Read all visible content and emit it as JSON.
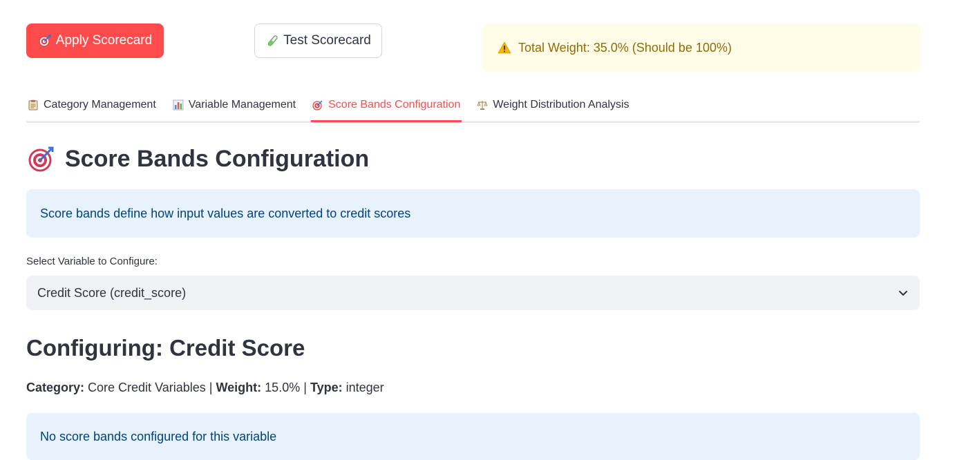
{
  "toolbar": {
    "apply_label": "Apply Scorecard",
    "test_label": "Test Scorecard",
    "colors": {
      "primary": "#ff4b4b",
      "secondary_border": "#d3d5da"
    }
  },
  "warning": {
    "text": "Total Weight: 35.0% (Should be 100%)",
    "icon": "warning-icon",
    "colors": {
      "bg": "#fffce7",
      "text": "#926c05"
    }
  },
  "tabs": [
    {
      "label": "Category Management",
      "icon": "clipboard-icon",
      "active": false
    },
    {
      "label": "Variable Management",
      "icon": "bar-chart-icon",
      "active": false
    },
    {
      "label": "Score Bands Configuration",
      "icon": "target-icon",
      "active": true
    },
    {
      "label": "Weight Distribution Analysis",
      "icon": "scales-icon",
      "active": false
    }
  ],
  "main": {
    "title": "Score Bands Configuration",
    "info_text": "Score bands define how input values are converted to credit scores",
    "select_label": "Select Variable to Configure:",
    "select_value": "Credit Score (credit_score)",
    "configuring_title": "Configuring: Credit Score",
    "meta": {
      "category_label": "Category:",
      "category_value": "Core Credit Variables",
      "sep1": "|",
      "weight_label": "Weight:",
      "weight_value": "15.0%",
      "sep2": "|",
      "type_label": "Type:",
      "type_value": "integer"
    },
    "empty_text": "No score bands configured for this variable"
  }
}
